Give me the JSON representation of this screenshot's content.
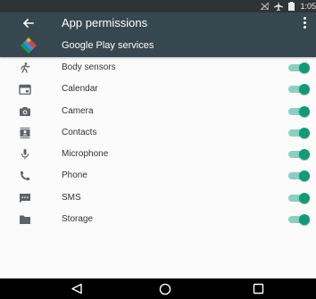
{
  "status_bar": {
    "time": "1:05"
  },
  "header": {
    "title": "App permissions",
    "back_icon": "arrow-back-icon",
    "more_icon": "more-vertical-icon"
  },
  "app": {
    "name": "Google Play services",
    "icon": "google-play-services-icon"
  },
  "permissions": [
    {
      "label": "Body sensors",
      "icon": "body-sensors-icon",
      "enabled": true
    },
    {
      "label": "Calendar",
      "icon": "calendar-icon",
      "enabled": true
    },
    {
      "label": "Camera",
      "icon": "camera-icon",
      "enabled": true
    },
    {
      "label": "Contacts",
      "icon": "contacts-icon",
      "enabled": true
    },
    {
      "label": "Microphone",
      "icon": "microphone-icon",
      "enabled": true
    },
    {
      "label": "Phone",
      "icon": "phone-icon",
      "enabled": true
    },
    {
      "label": "SMS",
      "icon": "sms-icon",
      "enabled": true
    },
    {
      "label": "Storage",
      "icon": "storage-icon",
      "enabled": true
    }
  ],
  "colors": {
    "app_bar": "#37474f",
    "status_bar": "#2d3436",
    "toggle_on_thumb": "#109b78",
    "toggle_on_track": "#8dcfbe"
  }
}
